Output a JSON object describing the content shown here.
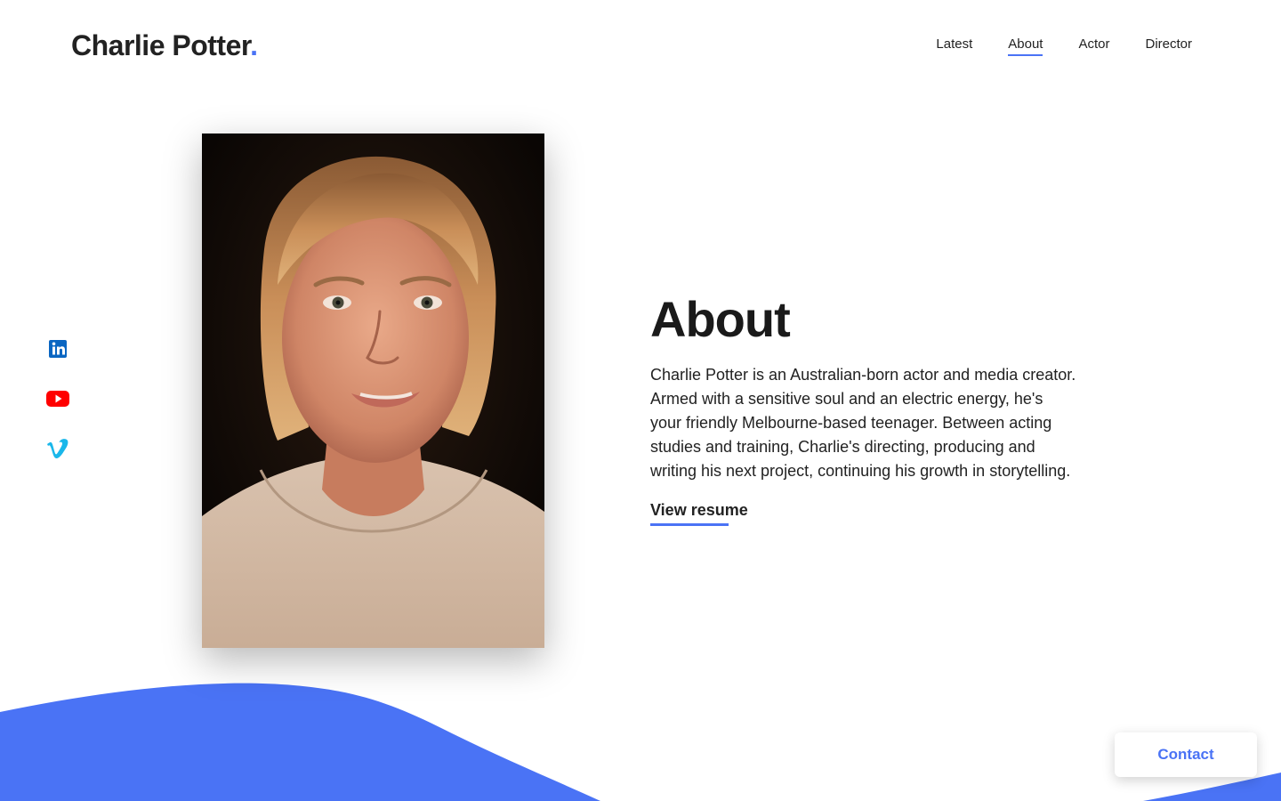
{
  "header": {
    "logo_text": "Charlie Potter",
    "logo_dot": ".",
    "nav": [
      {
        "label": "Latest",
        "active": false
      },
      {
        "label": "About",
        "active": true
      },
      {
        "label": "Actor",
        "active": false
      },
      {
        "label": "Director",
        "active": false
      }
    ]
  },
  "social": [
    {
      "icon": "linkedin-icon",
      "color": "#0a66c2"
    },
    {
      "icon": "youtube-icon",
      "color": "#ff0000"
    },
    {
      "icon": "vimeo-icon",
      "color": "#1ab7ea"
    }
  ],
  "about": {
    "title": "About",
    "text": "Charlie Potter is an Australian-born actor and media creator. Armed with a sensitive soul and an electric energy, he's your friendly Melbourne-based teenager. Between acting studies and training, Charlie's directing, producing and writing his next project, continuing his growth in storytelling.",
    "resume_label": "View resume"
  },
  "contact": {
    "label": "Contact"
  },
  "colors": {
    "accent": "#4a73f5",
    "text": "#222222",
    "background": "#ffffff"
  }
}
